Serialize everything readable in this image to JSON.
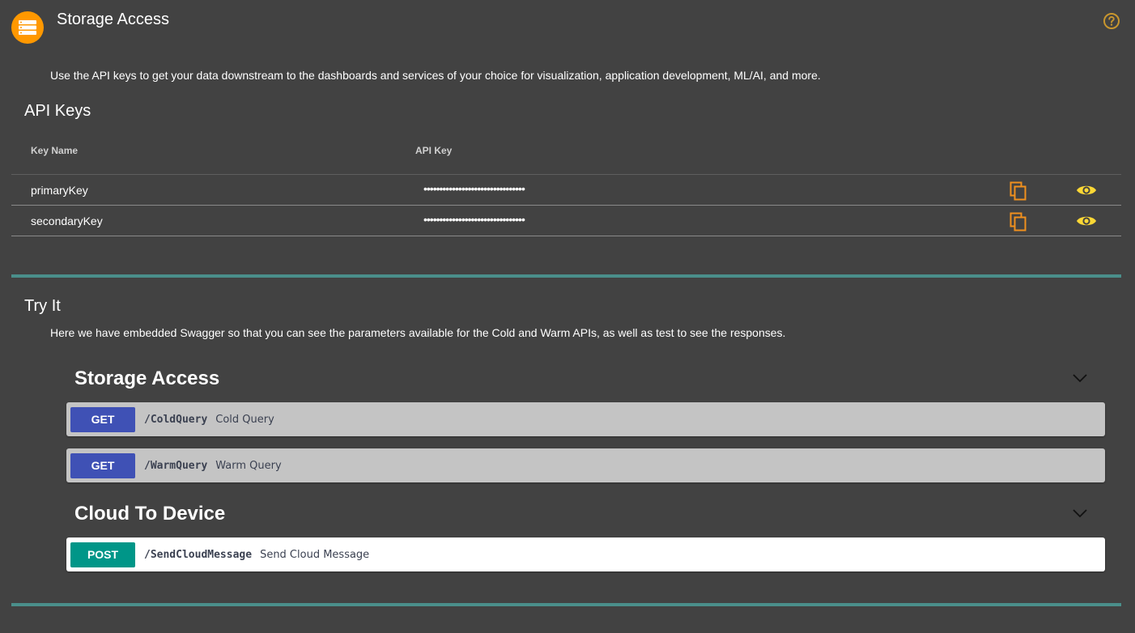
{
  "header": {
    "title": "Storage Access",
    "app_icon": "storage-icon",
    "help_icon": "help-circle-icon"
  },
  "intro": "Use the API keys to get your data downstream to the dashboards and services of your choice for visualization, application development, ML/AI, and more.",
  "api_keys": {
    "title": "API Keys",
    "columns": [
      "Key Name",
      "API Key"
    ],
    "rows": [
      {
        "name": "primaryKey",
        "value": "••••••••••••••••••••••••••••••••"
      },
      {
        "name": "secondaryKey",
        "value": "••••••••••••••••••••••••••••••••"
      }
    ],
    "copy_icon": "copy-icon",
    "view_icon": "eye-icon"
  },
  "try_it": {
    "title": "Try It",
    "description": "Here we have embedded Swagger so that you can see the parameters available for the Cold and Warm APIs, as well as test to see the responses."
  },
  "swagger": {
    "groups": [
      {
        "title": "Storage Access",
        "operations": [
          {
            "method": "GET",
            "path": "/ColdQuery",
            "summary": "Cold Query"
          },
          {
            "method": "GET",
            "path": "/WarmQuery",
            "summary": "Warm Query"
          }
        ]
      },
      {
        "title": "Cloud To Device",
        "operations": [
          {
            "method": "POST",
            "path": "/SendCloudMessage",
            "summary": "Send Cloud Message"
          }
        ]
      }
    ]
  },
  "colors": {
    "background": "#424242",
    "accent_orange": "#ff9800",
    "eye_yellow": "#fdd835",
    "divider_teal": "#4a8f8b",
    "get_blue": "#3f51b5",
    "post_teal": "#009688"
  }
}
